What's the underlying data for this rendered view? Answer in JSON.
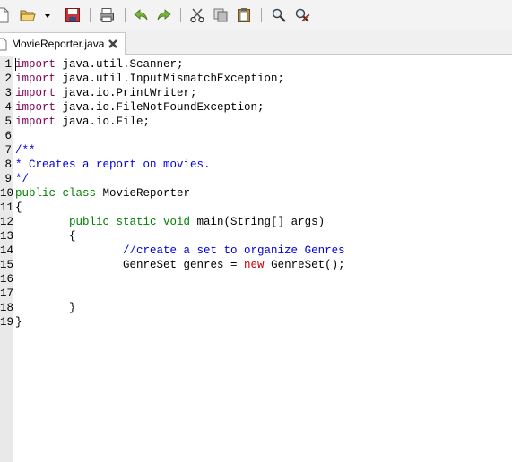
{
  "toolbar": {
    "icons": [
      "new-file-icon",
      "open-folder-icon",
      "dropdown-arrow-icon",
      "save-icon",
      "print-icon",
      "undo-icon",
      "redo-icon",
      "cut-icon",
      "copy-icon",
      "paste-icon",
      "find-icon",
      "find-replace-icon"
    ]
  },
  "tab": {
    "label": "MovieReporter.java"
  },
  "editor": {
    "lines": [
      {
        "n": "1",
        "parts": [
          {
            "c": "kw-import",
            "t": "import"
          },
          {
            "c": "",
            "t": " java.util.Scanner;"
          }
        ]
      },
      {
        "n": "2",
        "parts": [
          {
            "c": "kw-import",
            "t": "import"
          },
          {
            "c": "",
            "t": " java.util.InputMismatchException;"
          }
        ]
      },
      {
        "n": "3",
        "parts": [
          {
            "c": "kw-import",
            "t": "import"
          },
          {
            "c": "",
            "t": " java.io.PrintWriter;"
          }
        ]
      },
      {
        "n": "4",
        "parts": [
          {
            "c": "kw-import",
            "t": "import"
          },
          {
            "c": "",
            "t": " java.io.FileNotFoundException;"
          }
        ]
      },
      {
        "n": "5",
        "parts": [
          {
            "c": "kw-import",
            "t": "import"
          },
          {
            "c": "",
            "t": " java.io.File;"
          }
        ]
      },
      {
        "n": "6",
        "parts": []
      },
      {
        "n": "7",
        "parts": [
          {
            "c": "cm",
            "t": "/**"
          }
        ]
      },
      {
        "n": "8",
        "parts": [
          {
            "c": "cm",
            "t": "* Creates a report on movies."
          }
        ]
      },
      {
        "n": "9",
        "parts": [
          {
            "c": "cm",
            "t": "*/"
          }
        ]
      },
      {
        "n": "10",
        "parts": [
          {
            "c": "kw",
            "t": "public class"
          },
          {
            "c": "",
            "t": " MovieReporter"
          }
        ]
      },
      {
        "n": "11",
        "parts": [
          {
            "c": "",
            "t": "{"
          }
        ]
      },
      {
        "n": "12",
        "parts": [
          {
            "c": "",
            "t": "        "
          },
          {
            "c": "kw",
            "t": "public static void"
          },
          {
            "c": "",
            "t": " main(String[] args)"
          }
        ]
      },
      {
        "n": "13",
        "parts": [
          {
            "c": "",
            "t": "        {"
          }
        ]
      },
      {
        "n": "14",
        "parts": [
          {
            "c": "",
            "t": "                "
          },
          {
            "c": "cm",
            "t": "//create a set to organize Genres"
          }
        ]
      },
      {
        "n": "15",
        "parts": [
          {
            "c": "",
            "t": "                GenreSet genres = "
          },
          {
            "c": "kw-new",
            "t": "new"
          },
          {
            "c": "",
            "t": " GenreSet();"
          }
        ]
      },
      {
        "n": "16",
        "parts": []
      },
      {
        "n": "17",
        "parts": []
      },
      {
        "n": "18",
        "parts": [
          {
            "c": "",
            "t": "        }"
          }
        ]
      },
      {
        "n": "19",
        "parts": [
          {
            "c": "",
            "t": "}"
          }
        ]
      }
    ]
  }
}
